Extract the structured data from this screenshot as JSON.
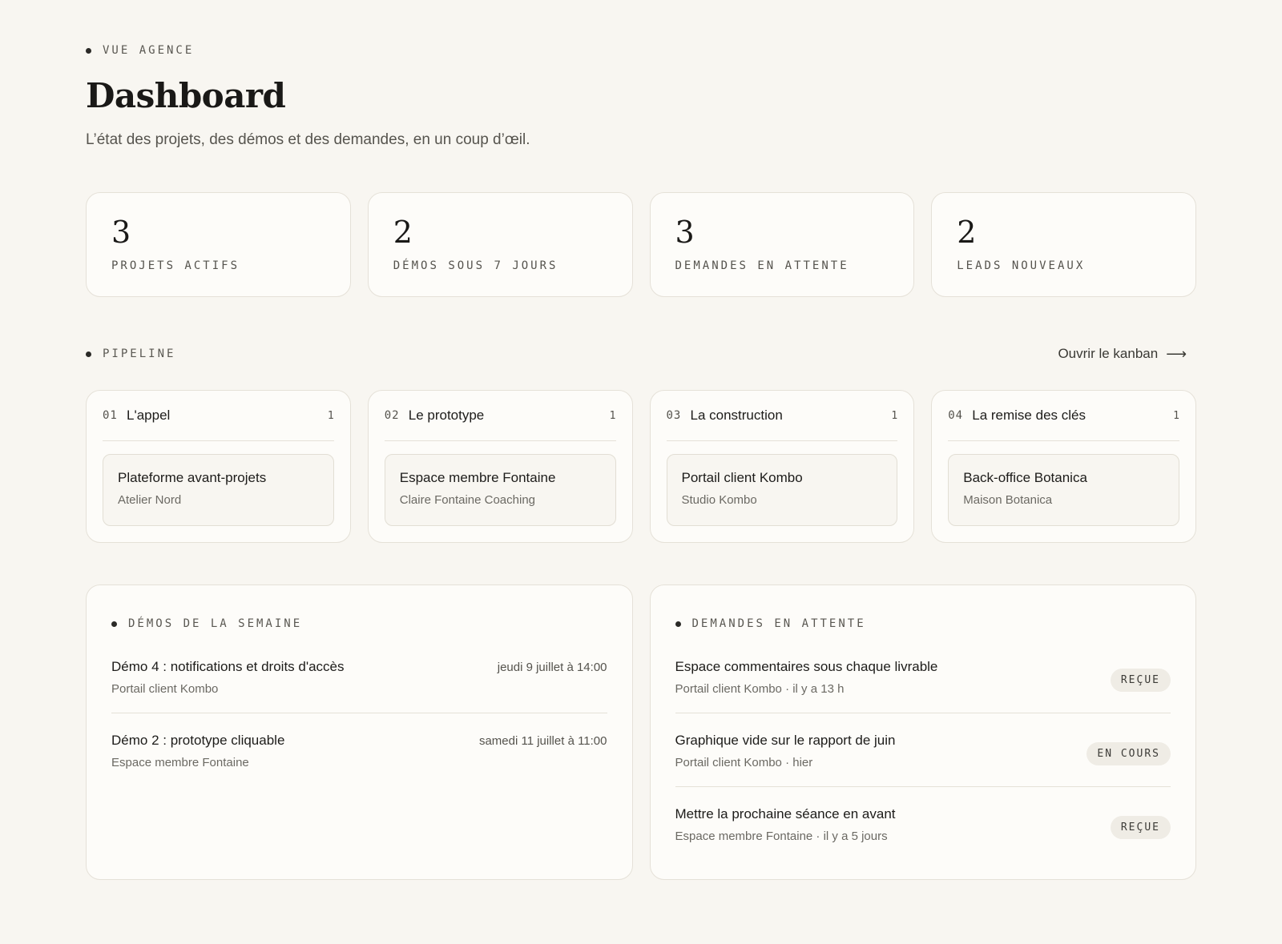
{
  "header": {
    "eyebrow": "VUE AGENCE",
    "title": "Dashboard",
    "subtitle": "L’état des projets, des démos et des demandes, en un coup d’œil."
  },
  "stats": [
    {
      "value": "3",
      "label": "PROJETS ACTIFS"
    },
    {
      "value": "2",
      "label": "DÉMOS SOUS 7 JOURS"
    },
    {
      "value": "3",
      "label": "DEMANDES EN ATTENTE"
    },
    {
      "value": "2",
      "label": "LEADS NOUVEAUX"
    }
  ],
  "pipeline": {
    "label": "PIPELINE",
    "link_label": "Ouvrir le kanban",
    "link_icon": "arrow-right-icon",
    "stages": [
      {
        "num": "01",
        "name": "L'appel",
        "count": "1",
        "project": {
          "name": "Plateforme avant-projets",
          "client": "Atelier Nord"
        }
      },
      {
        "num": "02",
        "name": "Le prototype",
        "count": "1",
        "project": {
          "name": "Espace membre Fontaine",
          "client": "Claire Fontaine Coaching"
        }
      },
      {
        "num": "03",
        "name": "La construction",
        "count": "1",
        "project": {
          "name": "Portail client Kombo",
          "client": "Studio Kombo"
        }
      },
      {
        "num": "04",
        "name": "La remise des clés",
        "count": "1",
        "project": {
          "name": "Back-office Botanica",
          "client": "Maison Botanica"
        }
      }
    ]
  },
  "demos": {
    "label": "DÉMOS DE LA SEMAINE",
    "items": [
      {
        "title": "Démo 4 : notifications et droits d'accès",
        "project": "Portail client Kombo",
        "date": "jeudi 9 juillet à 14:00"
      },
      {
        "title": "Démo 2 : prototype cliquable",
        "project": "Espace membre Fontaine",
        "date": "samedi 11 juillet à 11:00"
      }
    ]
  },
  "requests": {
    "label": "DEMANDES EN ATTENTE",
    "items": [
      {
        "title": "Espace commentaires sous chaque livrable",
        "meta": "Portail client Kombo · il y a 13 h",
        "status": "REÇUE"
      },
      {
        "title": "Graphique vide sur le rapport de juin",
        "meta": "Portail client Kombo · hier",
        "status": "EN COURS"
      },
      {
        "title": "Mettre la prochaine séance en avant",
        "meta": "Espace membre Fontaine · il y a 5 jours",
        "status": "REÇUE"
      }
    ]
  },
  "colors": {
    "background": "#f8f6f1",
    "card": "#fdfcf9",
    "border": "#e5e1d8",
    "text": "#1d1c1a",
    "muted": "#6b6963",
    "badge": "#efece5"
  }
}
